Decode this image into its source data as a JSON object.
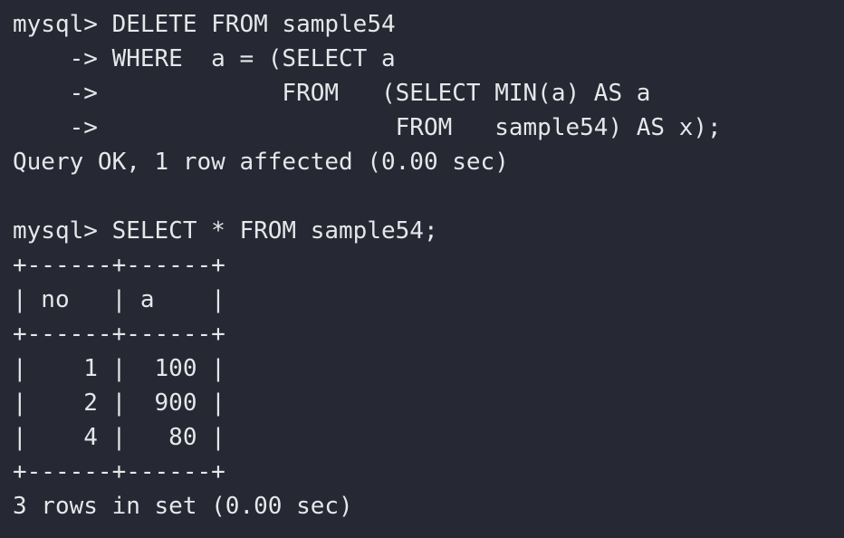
{
  "terminal": {
    "lines": [
      "mysql> DELETE FROM sample54",
      "    -> WHERE  a = (SELECT a",
      "    ->             FROM   (SELECT MIN(a) AS a",
      "    ->                     FROM   sample54) AS x);",
      "Query OK, 1 row affected (0.00 sec)",
      "",
      "mysql> SELECT * FROM sample54;",
      "+------+------+",
      "| no   | a    |",
      "+------+------+",
      "|    1 |  100 |",
      "|    2 |  900 |",
      "|    4 |   80 |",
      "+------+------+",
      "3 rows in set (0.00 sec)"
    ]
  }
}
